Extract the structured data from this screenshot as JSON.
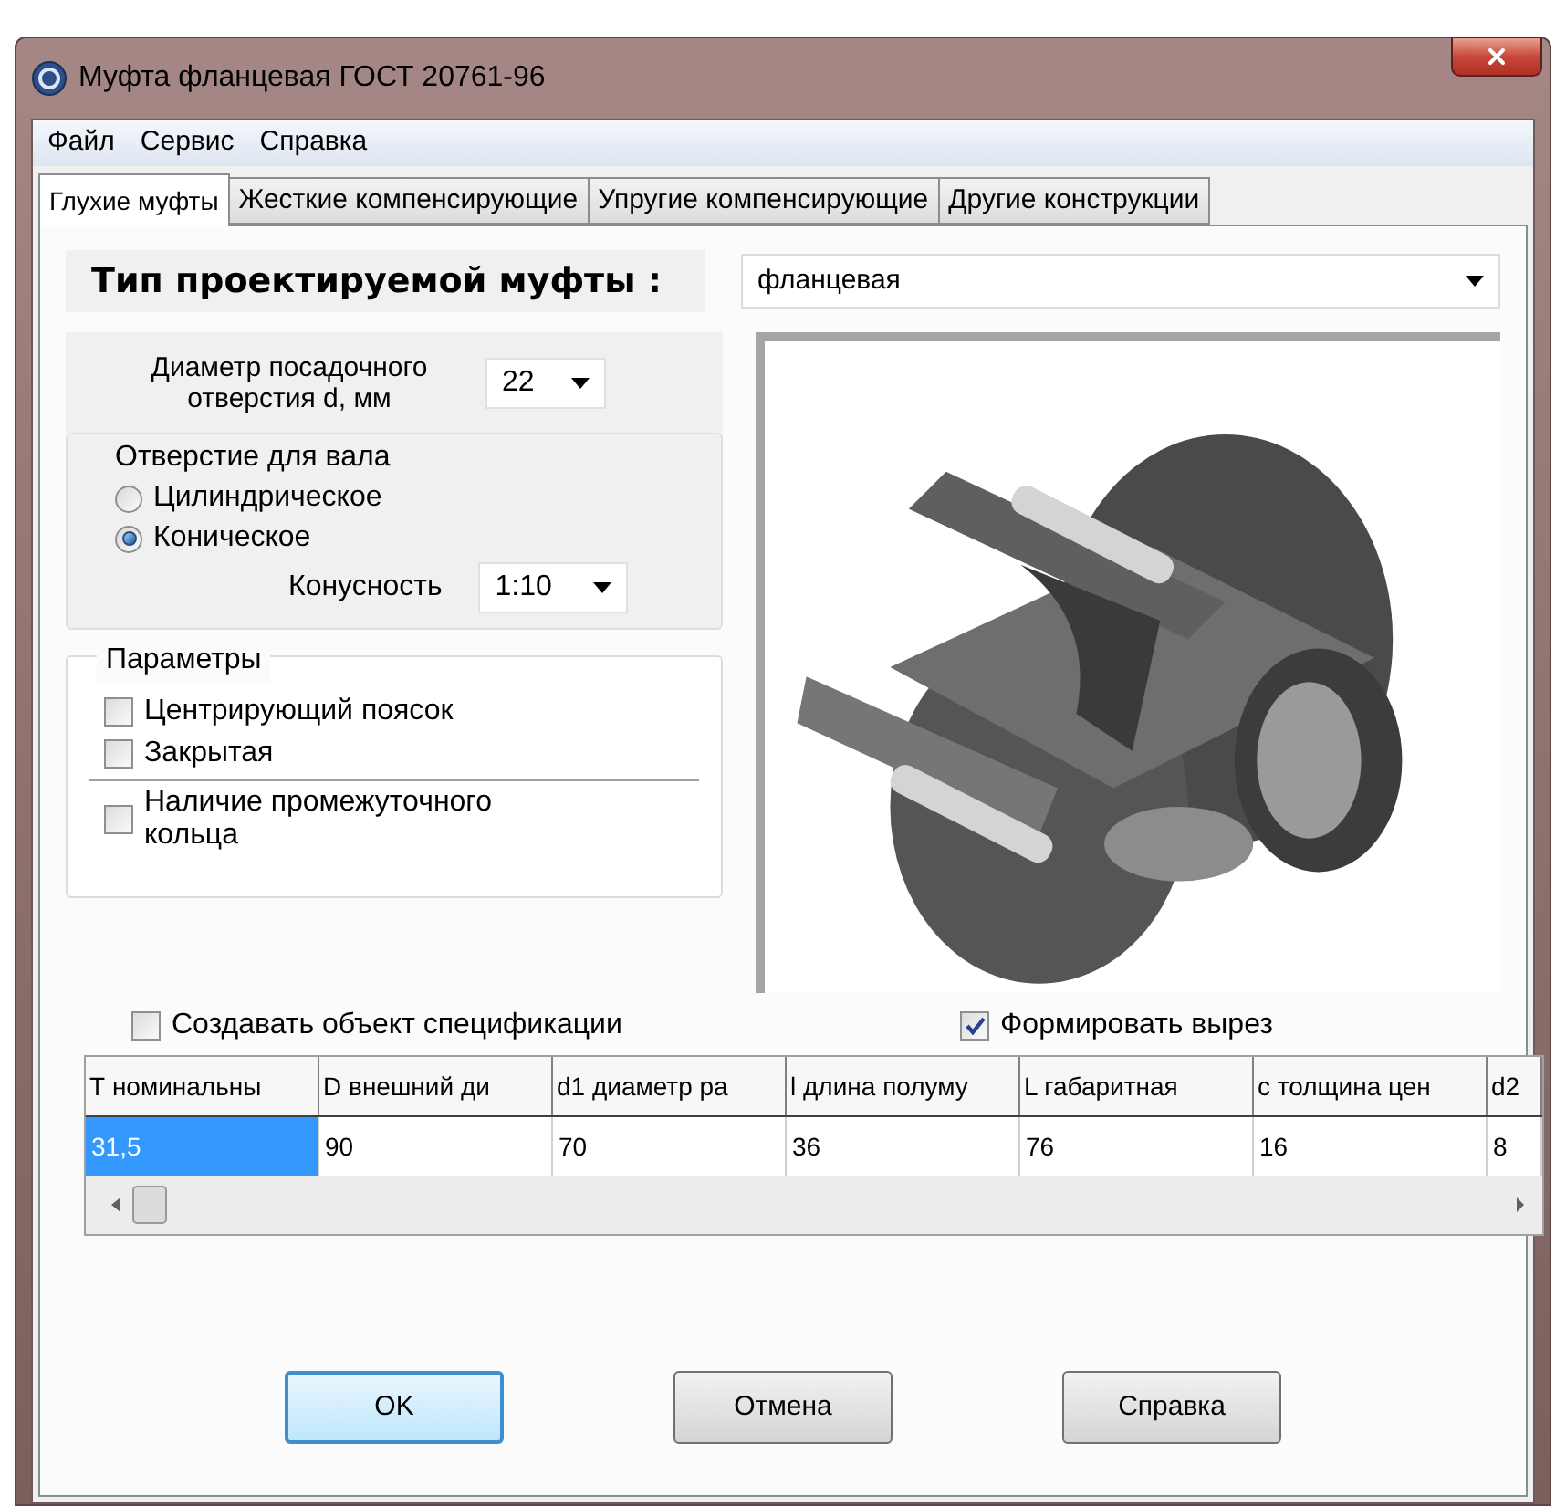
{
  "window": {
    "title": "Муфта фланцевая ГОСТ 20761-96"
  },
  "menu": [
    "Файл",
    "Сервис",
    "Справка"
  ],
  "tabs": [
    {
      "label": "Глухие муфты",
      "selected": true
    },
    {
      "label": "Жесткие компенсирующие",
      "selected": false
    },
    {
      "label": "Упругие компенсирующие",
      "selected": false
    },
    {
      "label": "Другие конструкции",
      "selected": false
    }
  ],
  "coupling_type": {
    "label": "Тип проектируемой муфты :",
    "value": "фланцевая"
  },
  "bore_diameter": {
    "label": "Диаметр посадочного отверстия d, мм",
    "value": "22"
  },
  "shaft_hole": {
    "title": "Отверстие для вала",
    "options": [
      {
        "label": "Цилиндрическое",
        "selected": false
      },
      {
        "label": "Коническое",
        "selected": true
      }
    ],
    "taper": {
      "label": "Конусность",
      "value": "1:10"
    }
  },
  "parameters": {
    "title": "Параметры",
    "options": [
      {
        "label": "Центрирующий поясок",
        "checked": false
      },
      {
        "label": "Закрытая",
        "checked": false
      }
    ],
    "extra": {
      "label": "Наличие промежуточного кольца",
      "checked": false
    }
  },
  "create_spec": {
    "label": "Создавать объект спецификации",
    "checked": false
  },
  "make_cutout": {
    "label": "Формировать вырез",
    "checked": true
  },
  "table": {
    "columns": [
      "Т номинальны",
      "D внешний ди",
      "d1 диаметр ра",
      "l длина полуму",
      "L габаритная",
      "с толщина цен",
      "d2"
    ],
    "rows": [
      {
        "cells": [
          {
            "text": "31,5",
            "selected": true
          },
          {
            "text": "90",
            "selected": false
          },
          {
            "text": "70",
            "selected": false
          },
          {
            "text": "36",
            "selected": false
          },
          {
            "text": "76",
            "selected": false
          },
          {
            "text": "16",
            "selected": false
          },
          {
            "text": "8",
            "selected": false
          }
        ]
      }
    ]
  },
  "buttons": [
    {
      "label": "OK",
      "focused": true
    },
    {
      "label": "Отмена",
      "focused": false
    },
    {
      "label": "Справка",
      "focused": false
    }
  ]
}
